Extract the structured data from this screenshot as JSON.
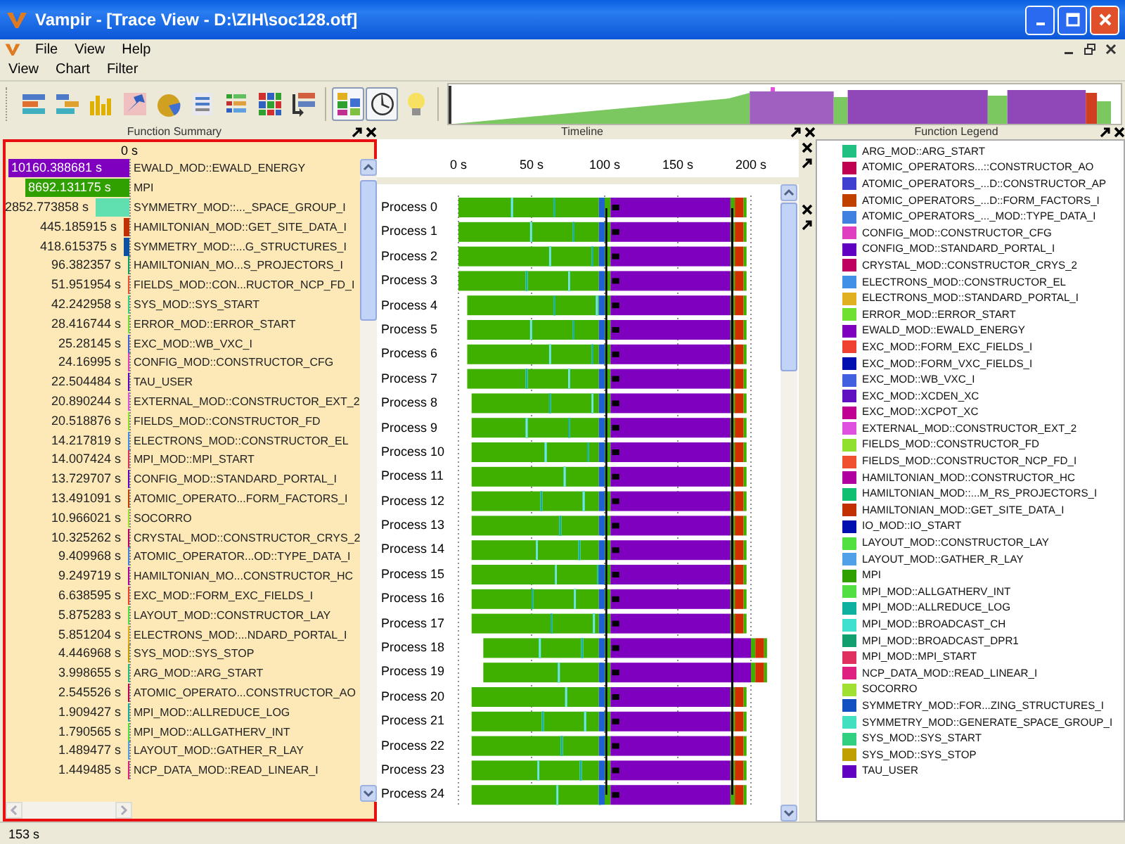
{
  "window": {
    "title": "Vampir - [Trace View - D:\\ZIH\\soc128.otf]"
  },
  "menubar": [
    "File",
    "View",
    "Help"
  ],
  "view_menubar": [
    "View",
    "Chart",
    "Filter"
  ],
  "toolbar": [
    {
      "pressed": false
    },
    {
      "pressed": false
    },
    {
      "pressed": false
    },
    {
      "pressed": false
    },
    {
      "pressed": false
    },
    {
      "pressed": false
    },
    {
      "pressed": false
    },
    {
      "pressed": false
    },
    {
      "pressed": false
    },
    {
      "pressed": true
    },
    {
      "pressed": true
    },
    {
      "pressed": false
    }
  ],
  "summary": {
    "title": "Function Summary",
    "axis_label": "0 s",
    "rows": [
      {
        "value": "10160.388681 s",
        "label": "EWALD_MOD::EWALD_ENERGY",
        "color": "#8000c0",
        "level": 1
      },
      {
        "value": "8692.131175 s",
        "label": "MPI",
        "color": "#30a000",
        "level": 0.8555
      },
      {
        "value": "2852.773858 s",
        "label": "SYMMETRY_MOD::..._SPACE_GROUP_I",
        "color": "#60e0b0",
        "level": 0.2808
      },
      {
        "value": "445.185915 s",
        "label": "HAMILTONIAN_MOD::GET_SITE_DATA_I",
        "color": "#c03000",
        "level": 0.0438
      },
      {
        "value": "418.615375 s",
        "label": "SYMMETRY_MOD::...G_STRUCTURES_I",
        "color": "#1050a0",
        "level": 0.0412
      },
      {
        "value": "96.382357 s",
        "label": "HAMILTONIAN_MO...S_PROJECTORS_I",
        "color": "#10a060",
        "level": 0.0095
      },
      {
        "value": "51.951954 s",
        "label": "FIELDS_MOD::CON...RUCTOR_NCP_FD_I",
        "color": "#f05030",
        "level": 0.0051
      },
      {
        "value": "42.242958 s",
        "label": "SYS_MOD::SYS_START",
        "color": "#30d080",
        "level": 0.0042
      },
      {
        "value": "28.416744 s",
        "label": "ERROR_MOD::ERROR_START",
        "color": "#70e030",
        "level": 0.0028
      },
      {
        "value": "25.28145 s",
        "label": "EXC_MOD::WB_VXC_I",
        "color": "#4060e0",
        "level": 0.0025
      },
      {
        "value": "24.16995 s",
        "label": "CONFIG_MOD::CONSTRUCTOR_CFG",
        "color": "#e040c0",
        "level": 0.0024
      },
      {
        "value": "22.504484 s",
        "label": "TAU_USER",
        "color": "#6000c0",
        "level": 0.0022
      },
      {
        "value": "20.890244 s",
        "label": "EXTERNAL_MOD::CONSTRUCTOR_EXT_2",
        "color": "#e050e0",
        "level": 0.0021
      },
      {
        "value": "20.518876 s",
        "label": "FIELDS_MOD::CONSTRUCTOR_FD",
        "color": "#90e030",
        "level": 0.002
      },
      {
        "value": "14.217819 s",
        "label": "ELECTRONS_MOD::CONSTRUCTOR_EL",
        "color": "#4090e8",
        "level": 0.0014
      },
      {
        "value": "14.007424 s",
        "label": "MPI_MOD::MPI_START",
        "color": "#e03060",
        "level": 0.0014
      },
      {
        "value": "13.729707 s",
        "label": "CONFIG_MOD::STANDARD_PORTAL_I",
        "color": "#6000c0",
        "level": 0.0014
      },
      {
        "value": "13.491091 s",
        "label": "ATOMIC_OPERATO...FORM_FACTORS_I",
        "color": "#c04000",
        "level": 0.0013
      },
      {
        "value": "10.966021 s",
        "label": "SOCORRO",
        "color": "#a0e030",
        "level": 0.0011
      },
      {
        "value": "10.325262 s",
        "label": "CRYSTAL_MOD::CONSTRUCTOR_CRYS_2",
        "color": "#c00060",
        "level": 0.001
      },
      {
        "value": "9.409968 s",
        "label": "ATOMIC_OPERATOR...OD::TYPE_DATA_I",
        "color": "#4080e0",
        "level": 0.0009
      },
      {
        "value": "9.249719 s",
        "label": "HAMILTONIAN_MO...CONSTRUCTOR_HC",
        "color": "#b000a0",
        "level": 0.0009
      },
      {
        "value": "6.638595 s",
        "label": "EXC_MOD::FORM_EXC_FIELDS_I",
        "color": "#f04030",
        "level": 0.0007
      },
      {
        "value": "5.875283 s",
        "label": "LAYOUT_MOD::CONSTRUCTOR_LAY",
        "color": "#50e040",
        "level": 0.0006
      },
      {
        "value": "5.851204 s",
        "label": "ELECTRONS_MOD:...NDARD_PORTAL_I",
        "color": "#e0b020",
        "level": 0.0006
      },
      {
        "value": "4.446968 s",
        "label": "SYS_MOD::SYS_STOP",
        "color": "#c0a000",
        "level": 0.0004
      },
      {
        "value": "3.998655 s",
        "label": "ARG_MOD::ARG_START",
        "color": "#20c080",
        "level": 0.0004
      },
      {
        "value": "2.545526 s",
        "label": "ATOMIC_OPERATO...CONSTRUCTOR_AO",
        "color": "#c00050",
        "level": 0.0003
      },
      {
        "value": "1.909427 s",
        "label": "MPI_MOD::ALLREDUCE_LOG",
        "color": "#10b0a0",
        "level": 0.0002
      },
      {
        "value": "1.790565 s",
        "label": "MPI_MOD::ALLGATHERV_INT",
        "color": "#50e040",
        "level": 0.0002
      },
      {
        "value": "1.489477 s",
        "label": "LAYOUT_MOD::GATHER_R_LAY",
        "color": "#50a0e8",
        "level": 0.0001
      },
      {
        "value": "1.449485 s",
        "label": "NCP_DATA_MOD::READ_LINEAR_I",
        "color": "#e02080",
        "level": 0.0001
      }
    ]
  },
  "timeline": {
    "title": "Timeline",
    "ticks": [
      "0 s",
      "50 s",
      "100 s",
      "150 s",
      "200 s"
    ],
    "processes": [
      "Process 0",
      "Process 1",
      "Process 2",
      "Process 3",
      "Process 4",
      "Process 5",
      "Process 6",
      "Process 7",
      "Process 8",
      "Process 9",
      "Process 10",
      "Process 11",
      "Process 12",
      "Process 13",
      "Process 14",
      "Process 15",
      "Process 16",
      "Process 17",
      "Process 18",
      "Process 19",
      "Process 20",
      "Process 21",
      "Process 22",
      "Process 23",
      "Process 24"
    ]
  },
  "legend": {
    "title": "Function Legend",
    "items": [
      {
        "label": "ARG_MOD::ARG_START",
        "color": "#20c080"
      },
      {
        "label": "ATOMIC_OPERATORS...::CONSTRUCTOR_AO",
        "color": "#c00050"
      },
      {
        "label": "ATOMIC_OPERATORS_...D::CONSTRUCTOR_AP",
        "color": "#4040d0"
      },
      {
        "label": "ATOMIC_OPERATORS_...D::FORM_FACTORS_I",
        "color": "#c04000"
      },
      {
        "label": "ATOMIC_OPERATORS_..._MOD::TYPE_DATA_I",
        "color": "#4080e0"
      },
      {
        "label": "CONFIG_MOD::CONSTRUCTOR_CFG",
        "color": "#e040c0"
      },
      {
        "label": "CONFIG_MOD::STANDARD_PORTAL_I",
        "color": "#6000c0"
      },
      {
        "label": "CRYSTAL_MOD::CONSTRUCTOR_CRYS_2",
        "color": "#c00060"
      },
      {
        "label": "ELECTRONS_MOD::CONSTRUCTOR_EL",
        "color": "#4090e8"
      },
      {
        "label": "ELECTRONS_MOD::STANDARD_PORTAL_I",
        "color": "#e0b020"
      },
      {
        "label": "ERROR_MOD::ERROR_START",
        "color": "#70e030"
      },
      {
        "label": "EWALD_MOD::EWALD_ENERGY",
        "color": "#8000c0"
      },
      {
        "label": "EXC_MOD::FORM_EXC_FIELDS_I",
        "color": "#f04030"
      },
      {
        "label": "EXC_MOD::FORM_VXC_FIELDS_I",
        "color": "#0010b0"
      },
      {
        "label": "EXC_MOD::WB_VXC_I",
        "color": "#4060e0"
      },
      {
        "label": "EXC_MOD::XCDEN_XC",
        "color": "#6010c0"
      },
      {
        "label": "EXC_MOD::XCPOT_XC",
        "color": "#c00090"
      },
      {
        "label": "EXTERNAL_MOD::CONSTRUCTOR_EXT_2",
        "color": "#e050e0"
      },
      {
        "label": "FIELDS_MOD::CONSTRUCTOR_FD",
        "color": "#90e030"
      },
      {
        "label": "FIELDS_MOD::CONSTRUCTOR_NCP_FD_I",
        "color": "#f05030"
      },
      {
        "label": "HAMILTONIAN_MOD::CONSTRUCTOR_HC",
        "color": "#b000a0"
      },
      {
        "label": "HAMILTONIAN_MOD::...M_RS_PROJECTORS_I",
        "color": "#10c070"
      },
      {
        "label": "HAMILTONIAN_MOD::GET_SITE_DATA_I",
        "color": "#c03000"
      },
      {
        "label": "IO_MOD::IO_START",
        "color": "#0010b0"
      },
      {
        "label": "LAYOUT_MOD::CONSTRUCTOR_LAY",
        "color": "#50e040"
      },
      {
        "label": "LAYOUT_MOD::GATHER_R_LAY",
        "color": "#50a0e8"
      },
      {
        "label": "MPI",
        "color": "#30a000"
      },
      {
        "label": "MPI_MOD::ALLGATHERV_INT",
        "color": "#50e041"
      },
      {
        "label": "MPI_MOD::ALLREDUCE_LOG",
        "color": "#10b0a0"
      },
      {
        "label": "MPI_MOD::BROADCAST_CH",
        "color": "#40e0d0"
      },
      {
        "label": "MPI_MOD::BROADCAST_DPR1",
        "color": "#10a070"
      },
      {
        "label": "MPI_MOD::MPI_START",
        "color": "#e03060"
      },
      {
        "label": "NCP_DATA_MOD::READ_LINEAR_I",
        "color": "#e02080"
      },
      {
        "label": "SOCORRO",
        "color": "#a0e030"
      },
      {
        "label": "SYMMETRY_MOD::FOR...ZING_STRUCTURES_I",
        "color": "#1050c0"
      },
      {
        "label": "SYMMETRY_MOD::GENERATE_SPACE_GROUP_I",
        "color": "#40e0c0"
      },
      {
        "label": "SYS_MOD::SYS_START",
        "color": "#30d080"
      },
      {
        "label": "SYS_MOD::SYS_STOP",
        "color": "#c0a000"
      },
      {
        "label": "TAU_USER",
        "color": "#6000c1"
      }
    ]
  },
  "status_bar": "153 s"
}
